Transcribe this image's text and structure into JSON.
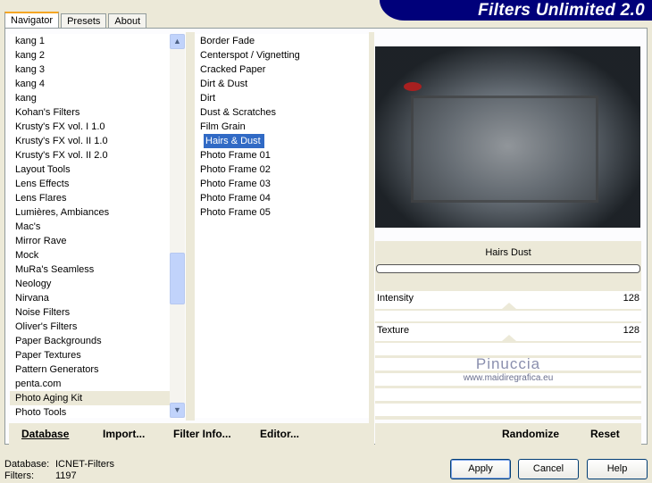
{
  "app": {
    "title": "Filters Unlimited 2.0"
  },
  "tabs": [
    "Navigator",
    "Presets",
    "About"
  ],
  "categories": [
    "kang 1",
    "kang 2",
    "kang 3",
    "kang 4",
    "kang",
    "Kohan's Filters",
    "Krusty's FX vol. I 1.0",
    "Krusty's FX vol. II 1.0",
    "Krusty's FX vol. II 2.0",
    "Layout Tools",
    "Lens Effects",
    "Lens Flares",
    "Lumières, Ambiances",
    "Mac's",
    "Mirror Rave",
    "Mock",
    "MuRa's Seamless",
    "Neology",
    "Nirvana",
    "Noise Filters",
    "Oliver's Filters",
    "Paper Backgrounds",
    "Paper Textures",
    "Pattern Generators",
    "penta.com",
    "Photo Aging Kit",
    "Photo Tools"
  ],
  "selected_category": "Photo Aging Kit",
  "filters": [
    "Border Fade",
    "Centerspot / Vignetting",
    "Cracked Paper",
    "Dirt & Dust",
    "Dirt",
    "Dust & Scratches",
    "Film Grain",
    "Hairs & Dust",
    "Photo Frame 01",
    "Photo Frame 02",
    "Photo Frame 03",
    "Photo Frame 04",
    "Photo Frame 05"
  ],
  "selected_filter": "Hairs & Dust",
  "params": {
    "title": "Hairs  Dust",
    "sliders": [
      {
        "label": "Intensity",
        "value": "128"
      },
      {
        "label": "Texture",
        "value": "128"
      }
    ]
  },
  "watermark": {
    "name": "Pinuccia",
    "url": "www.maidiregrafica.eu"
  },
  "left_buttons": [
    "Database",
    "Import...",
    "Filter Info...",
    "Editor..."
  ],
  "right_buttons": [
    "Randomize",
    "Reset"
  ],
  "status": {
    "database_label": "Database:",
    "database_value": "ICNET-Filters",
    "filters_label": "Filters:",
    "filters_value": "1197"
  },
  "dialog_buttons": {
    "apply": "Apply",
    "cancel": "Cancel",
    "help": "Help"
  }
}
